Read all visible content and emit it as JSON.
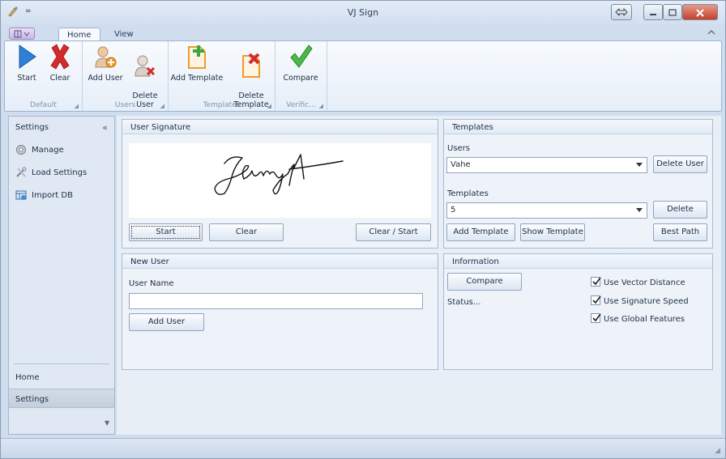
{
  "window": {
    "title": "VJ Sign",
    "qat_glyph": "="
  },
  "ribbon": {
    "tabs": [
      {
        "label": "Home",
        "active": true
      },
      {
        "label": "View",
        "active": false
      }
    ],
    "groups": [
      {
        "label": "Default",
        "buttons": [
          {
            "label": "Start",
            "icon": "play-icon"
          },
          {
            "label": "Clear",
            "icon": "red-x-icon"
          }
        ]
      },
      {
        "label": "Users",
        "buttons": [
          {
            "label": "Add User",
            "icon": "add-user-icon"
          },
          {
            "label": "Delete\nUser",
            "icon": "delete-user-icon"
          }
        ]
      },
      {
        "label": "Templates",
        "buttons": [
          {
            "label": "Add Template",
            "icon": "add-template-icon"
          },
          {
            "label": "Delete\nTemplate",
            "icon": "delete-template-icon"
          }
        ]
      },
      {
        "label": "Verific...",
        "buttons": [
          {
            "label": "Compare",
            "icon": "checkmark-icon"
          }
        ]
      }
    ]
  },
  "nav": {
    "header": "Settings",
    "collapse_glyph": "«",
    "items": [
      {
        "label": "Manage",
        "icon": "gear-icon"
      },
      {
        "label": "Load Settings",
        "icon": "tools-icon"
      },
      {
        "label": "Import DB",
        "icon": "database-icon"
      }
    ],
    "bottom_items": [
      {
        "label": "Home",
        "selected": false
      },
      {
        "label": "Settings",
        "selected": true
      }
    ]
  },
  "signature_panel": {
    "header": "User Signature",
    "buttons": {
      "start": "Start",
      "clear": "Clear",
      "clear_start": "Clear / Start"
    }
  },
  "new_user_panel": {
    "header": "New User",
    "field_label": "User Name",
    "field_value": "",
    "add_button": "Add User"
  },
  "templates_panel": {
    "header": "Templates",
    "users_label": "Users",
    "users_selected": "Vahe",
    "delete_user_button": "Delete User",
    "templates_label": "Templates",
    "templates_selected": "5",
    "delete_button": "Delete",
    "add_template_button": "Add Template",
    "show_template_button": "Show Template",
    "best_path_button": "Best Path"
  },
  "info_panel": {
    "header": "Information",
    "compare_button": "Compare",
    "status_text": "Status...",
    "options": [
      {
        "label": "Use Vector Distance",
        "checked": true
      },
      {
        "label": "Use Signature Speed",
        "checked": true
      },
      {
        "label": "Use Global Features",
        "checked": true
      }
    ]
  }
}
